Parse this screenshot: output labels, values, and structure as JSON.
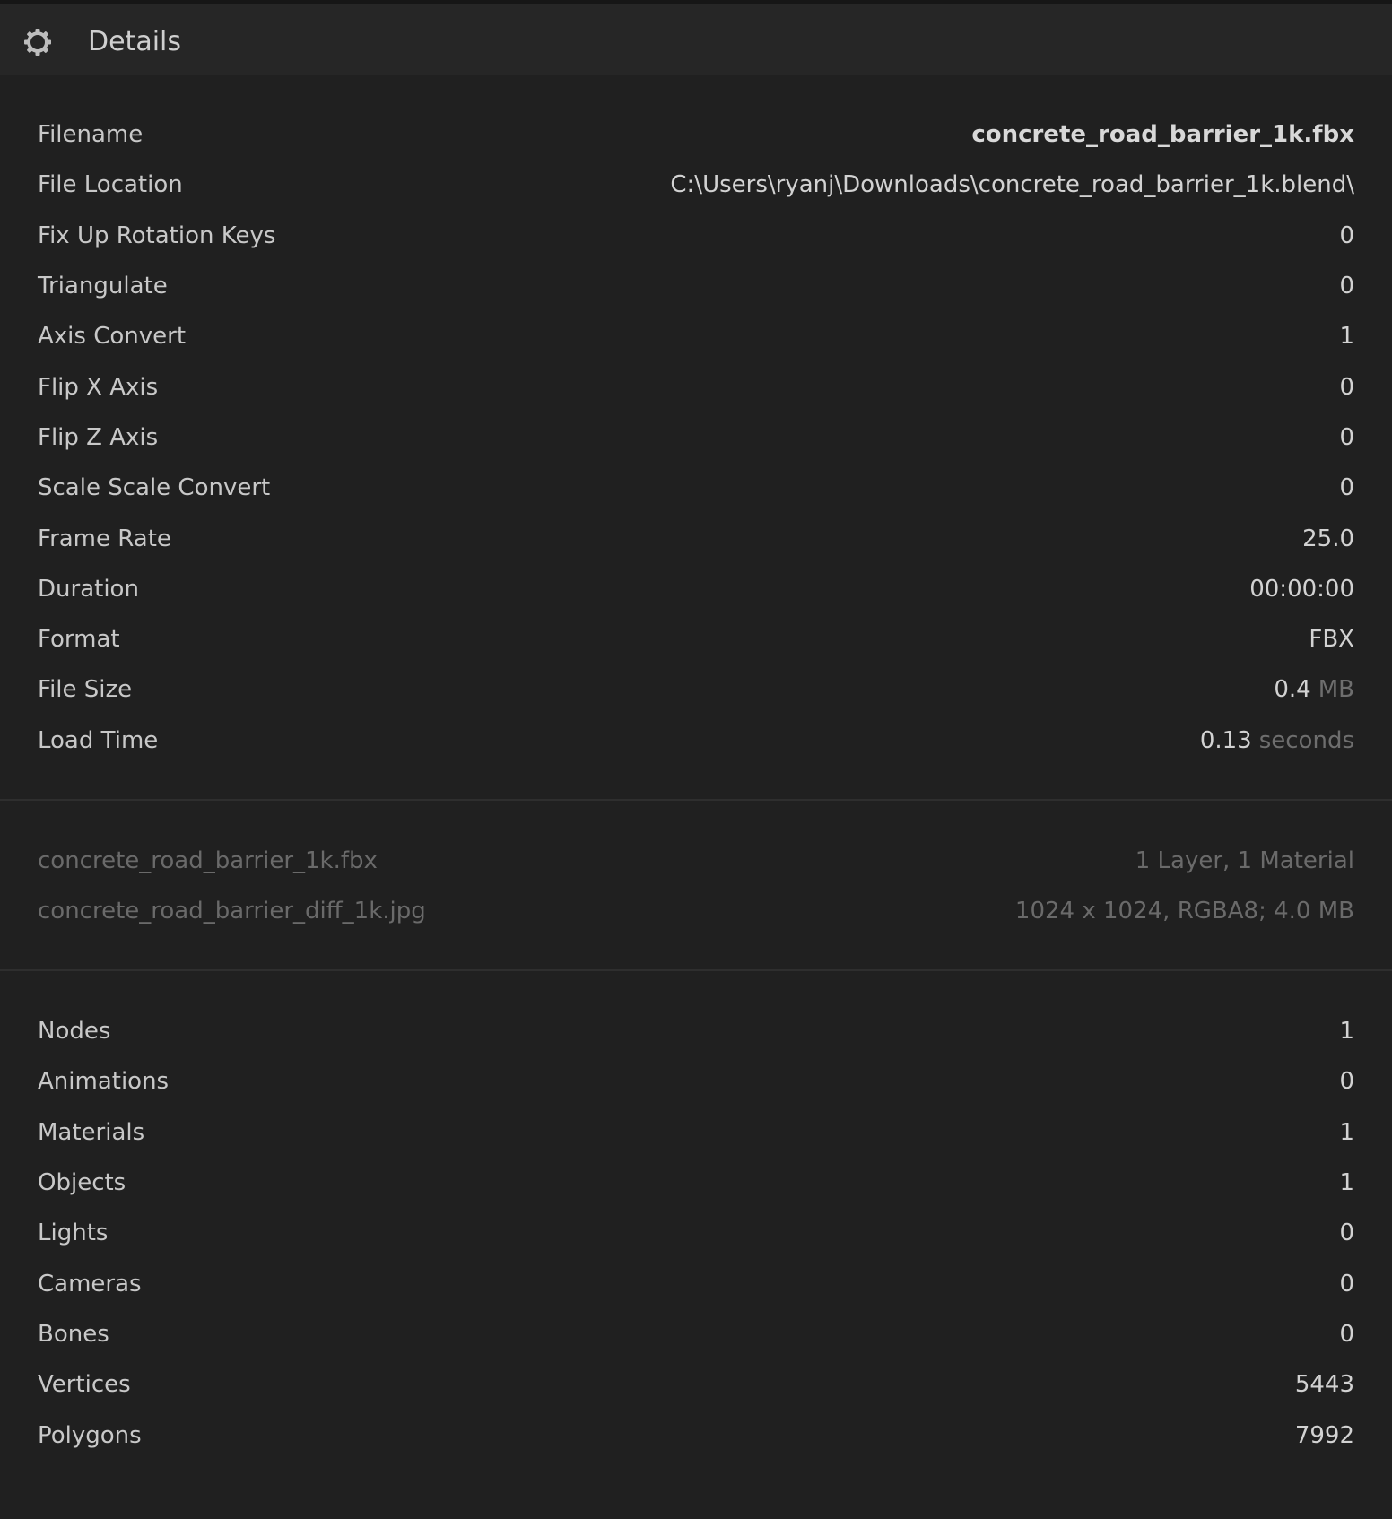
{
  "header": {
    "title": "Details",
    "icon": "gear-icon"
  },
  "properties": [
    {
      "label": "Filename",
      "value": "concrete_road_barrier_1k.fbx",
      "bold": true
    },
    {
      "label": "File Location",
      "value": "C:\\Users\\ryanj\\Downloads\\concrete_road_barrier_1k.blend\\"
    },
    {
      "label": "Fix Up Rotation Keys",
      "value": "0"
    },
    {
      "label": "Triangulate",
      "value": "0"
    },
    {
      "label": "Axis Convert",
      "value": "1"
    },
    {
      "label": "Flip X Axis",
      "value": "0"
    },
    {
      "label": "Flip Z Axis",
      "value": "0"
    },
    {
      "label": "Scale Scale Convert",
      "value": "0"
    },
    {
      "label": "Frame Rate",
      "value": "25.0"
    },
    {
      "label": "Duration",
      "value": "00:00:00"
    },
    {
      "label": "Format",
      "value": "FBX"
    },
    {
      "label": "File Size",
      "value": "0.4",
      "unit": "MB"
    },
    {
      "label": "Load Time",
      "value": "0.13",
      "unit": "seconds"
    }
  ],
  "files": [
    {
      "label": "concrete_road_barrier_1k.fbx",
      "value": "1 Layer, 1 Material"
    },
    {
      "label": "concrete_road_barrier_diff_1k.jpg",
      "value": "1024 x 1024, RGBA8; 4.0 MB"
    }
  ],
  "stats": [
    {
      "label": "Nodes",
      "value": "1"
    },
    {
      "label": "Animations",
      "value": "0"
    },
    {
      "label": "Materials",
      "value": "1"
    },
    {
      "label": "Objects",
      "value": "1"
    },
    {
      "label": "Lights",
      "value": "0"
    },
    {
      "label": "Cameras",
      "value": "0"
    },
    {
      "label": "Bones",
      "value": "0"
    },
    {
      "label": "Vertices",
      "value": "5443"
    },
    {
      "label": "Polygons",
      "value": "7992"
    }
  ]
}
